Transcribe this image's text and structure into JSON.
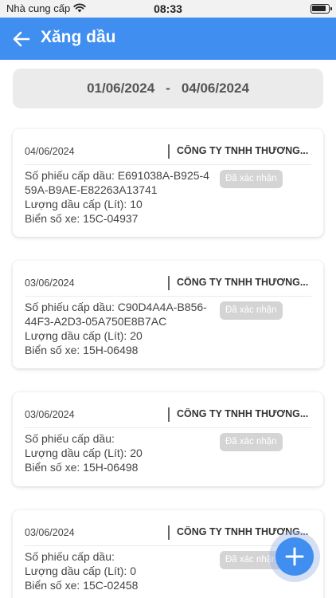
{
  "status_bar": {
    "carrier": "Nhà cung cấp",
    "time": "08:33"
  },
  "header": {
    "title": "Xăng dầu",
    "back_icon": "back-arrow-icon",
    "background": "#3f8ef0"
  },
  "date_range": {
    "from": "01/06/2024",
    "separator": "-",
    "to": "04/06/2024"
  },
  "records": [
    {
      "date": "04/06/2024",
      "company": "CÔNG TY TNHH THƯƠNG...",
      "ticket_label": "Số phiếu cấp dầu:",
      "ticket_no": "E691038A-B925-459A-B9AE-E82263A13741",
      "amount_label": "Lượng dầu cấp (Lít):",
      "amount": "10",
      "plate_label": "Biển số xe:",
      "plate": "15C-04937",
      "status": "Đã xác nhận"
    },
    {
      "date": "03/06/2024",
      "company": "CÔNG TY TNHH THƯƠNG...",
      "ticket_label": "Số phiếu cấp dầu:",
      "ticket_no": "C90D4A4A-B856-44F3-A2D3-05A750E8B7AC",
      "amount_label": "Lượng dầu cấp (Lít):",
      "amount": "20",
      "plate_label": "Biển số xe:",
      "plate": "15H-06498",
      "status": "Đã xác nhận"
    },
    {
      "date": "03/06/2024",
      "company": "CÔNG TY TNHH THƯƠNG...",
      "ticket_label": "Số phiếu cấp dầu:",
      "ticket_no": "",
      "amount_label": "Lượng dầu cấp (Lít):",
      "amount": "20",
      "plate_label": "Biển số xe:",
      "plate": "15H-06498",
      "status": "Đã xác nhận"
    },
    {
      "date": "03/06/2024",
      "company": "CÔNG TY TNHH THƯƠNG...",
      "ticket_label": "Số phiếu cấp dầu:",
      "ticket_no": "",
      "amount_label": "Lượng dầu cấp (Lít):",
      "amount": "0",
      "plate_label": "Biển số xe:",
      "plate": "15C-02458",
      "status": "Đã xác nhận"
    }
  ],
  "fab": {
    "icon": "plus-icon",
    "color": "#3f8ef0"
  }
}
